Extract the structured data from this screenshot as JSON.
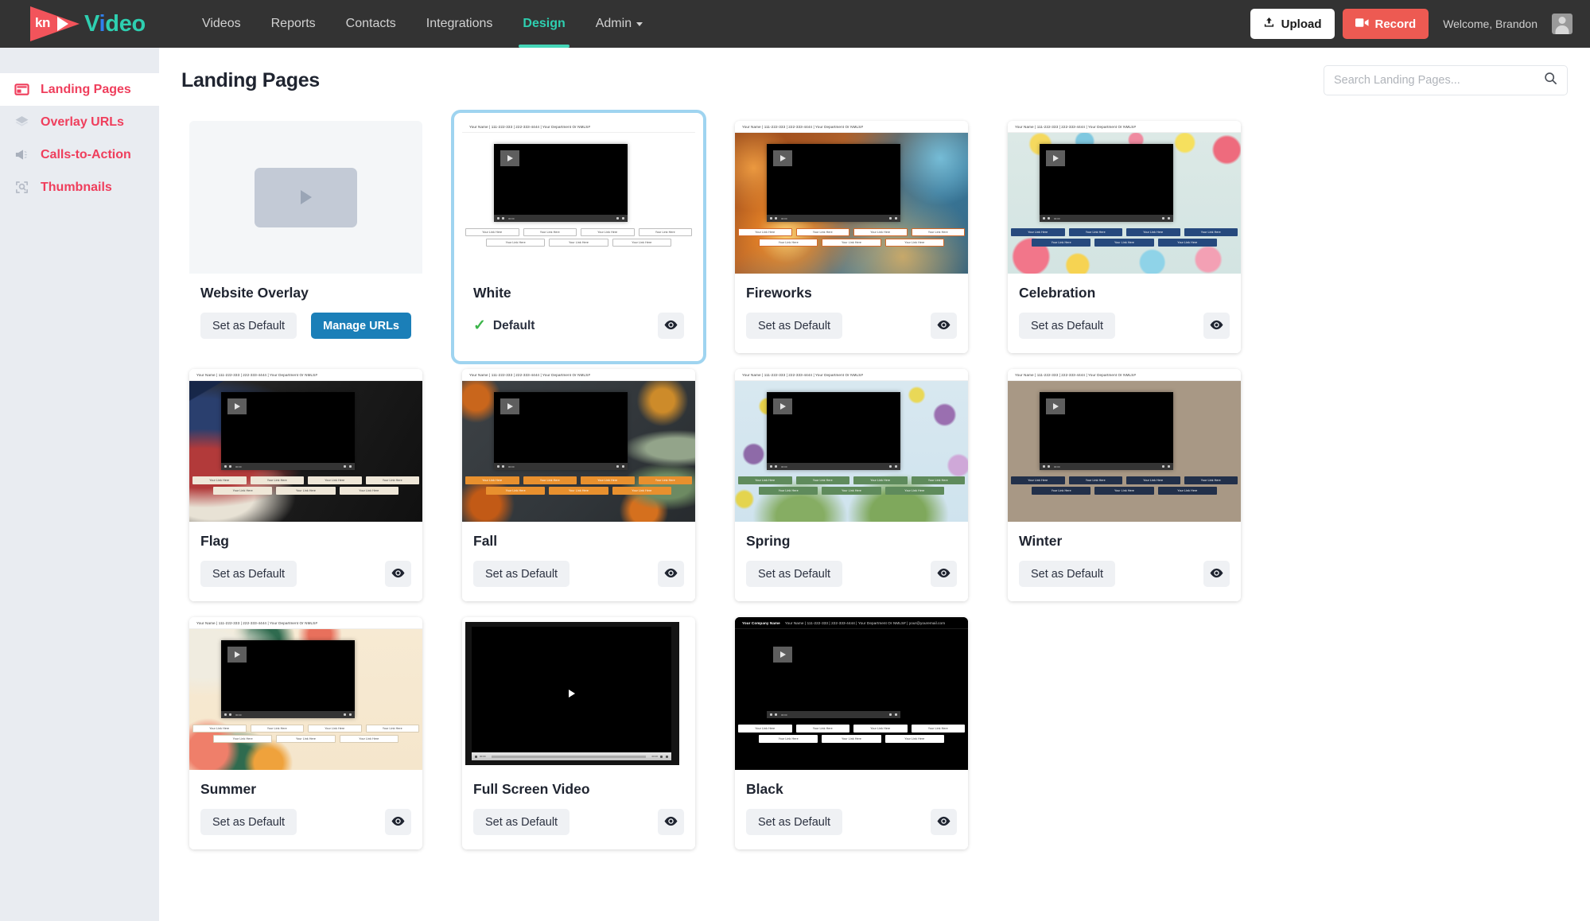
{
  "brand": {
    "logo_kn": "kn",
    "logo_word": "Video"
  },
  "nav": {
    "items": [
      {
        "label": "Videos",
        "active": false,
        "caret": false
      },
      {
        "label": "Reports",
        "active": false,
        "caret": false
      },
      {
        "label": "Contacts",
        "active": false,
        "caret": false
      },
      {
        "label": "Integrations",
        "active": false,
        "caret": false
      },
      {
        "label": "Design",
        "active": true,
        "caret": false
      },
      {
        "label": "Admin",
        "active": false,
        "caret": true
      }
    ],
    "upload_label": "Upload",
    "record_label": "Record",
    "welcome": "Welcome, Brandon"
  },
  "sidebar": {
    "items": [
      {
        "label": "Landing Pages",
        "icon": "landing-pages-icon",
        "active": true
      },
      {
        "label": "Overlay URLs",
        "icon": "layers-icon",
        "active": false
      },
      {
        "label": "Calls-to-Action",
        "icon": "megaphone-icon",
        "active": false
      },
      {
        "label": "Thumbnails",
        "icon": "thumbnail-search-icon",
        "active": false
      }
    ]
  },
  "header": {
    "title": "Landing Pages"
  },
  "search": {
    "placeholder": "Search Landing Pages...",
    "value": ""
  },
  "labels": {
    "set_as_default": "Set as Default",
    "manage_urls": "Manage URLs",
    "default": "Default",
    "preview": "Preview",
    "link_text": "Your Link Here",
    "header_line": "Your Name  |  111-222-333  |  222-333-4444  |  Your Department Or NMLS#",
    "black_company": "Your Company Name",
    "black_header_line": "Your Name  |  111-222-333  |  222-333-4444  |  Your Department Or NMLS#  |  your@youremail.com",
    "player_time": "00:00"
  },
  "colors": {
    "brand_pink": "#ef3e5c",
    "brand_teal": "#2ecfb0",
    "record_red": "#ed5a52",
    "manage_blue": "#1b7fb8",
    "selected_outline": "#9fd4f0",
    "check_green": "#3cb54a",
    "navbar_dark": "#333333",
    "sidebar_gray": "#e9ecf1"
  },
  "cards": [
    {
      "name": "Website Overlay",
      "kind": "placeholder",
      "theme": "",
      "is_default": false,
      "has_manage_urls": true,
      "has_preview": false,
      "link_style": ""
    },
    {
      "name": "White",
      "kind": "landing",
      "theme": "bg-white",
      "is_default": true,
      "selected": true,
      "has_manage_urls": false,
      "has_preview": true,
      "link_bg": "#ffffff",
      "link_color": "#444444",
      "link_border": "#bdbdbd"
    },
    {
      "name": "Fireworks",
      "kind": "landing",
      "theme": "bg-fireworks",
      "is_default": false,
      "has_manage_urls": false,
      "has_preview": true,
      "link_bg": "#ffffff",
      "link_color": "#444444",
      "link_border": "#d46a2a"
    },
    {
      "name": "Celebration",
      "kind": "landing",
      "theme": "bg-celebration",
      "is_default": false,
      "has_manage_urls": false,
      "has_preview": true,
      "link_bg": "#26497d",
      "link_color": "#ffffff",
      "link_border": "#1d3b66"
    },
    {
      "name": "Flag",
      "kind": "landing",
      "theme": "bg-flag",
      "is_default": false,
      "has_manage_urls": false,
      "has_preview": true,
      "link_bg": "#efe7d8",
      "link_color": "#3a3a3a",
      "link_border": "#cfc4ae"
    },
    {
      "name": "Fall",
      "kind": "landing",
      "theme": "bg-fall",
      "is_default": false,
      "has_manage_urls": false,
      "has_preview": true,
      "link_bg": "#e8902e",
      "link_color": "#ffffff",
      "link_border": "#c97a1e"
    },
    {
      "name": "Spring",
      "kind": "landing",
      "theme": "bg-spring",
      "is_default": false,
      "has_manage_urls": false,
      "has_preview": true,
      "link_bg": "#5f8b5c",
      "link_color": "#ffffff",
      "link_border": "#4e7a4c"
    },
    {
      "name": "Winter",
      "kind": "landing",
      "theme": "bg-winter",
      "is_default": false,
      "has_manage_urls": false,
      "has_preview": true,
      "link_bg": "#22304a",
      "link_color": "#ffffff",
      "link_border": "#192440"
    },
    {
      "name": "Summer",
      "kind": "landing",
      "theme": "bg-summer",
      "is_default": false,
      "has_manage_urls": false,
      "has_preview": true,
      "link_bg": "#ffffff",
      "link_color": "#444444",
      "link_border": "#d8cbb2"
    },
    {
      "name": "Full Screen Video",
      "kind": "fullscreen",
      "theme": "",
      "is_default": false,
      "has_manage_urls": false,
      "has_preview": true
    },
    {
      "name": "Black",
      "kind": "landing-black",
      "theme": "bg-black",
      "is_default": false,
      "has_manage_urls": false,
      "has_preview": true,
      "link_bg": "#ffffff",
      "link_color": "#333333",
      "link_border": "#cccccc"
    }
  ]
}
